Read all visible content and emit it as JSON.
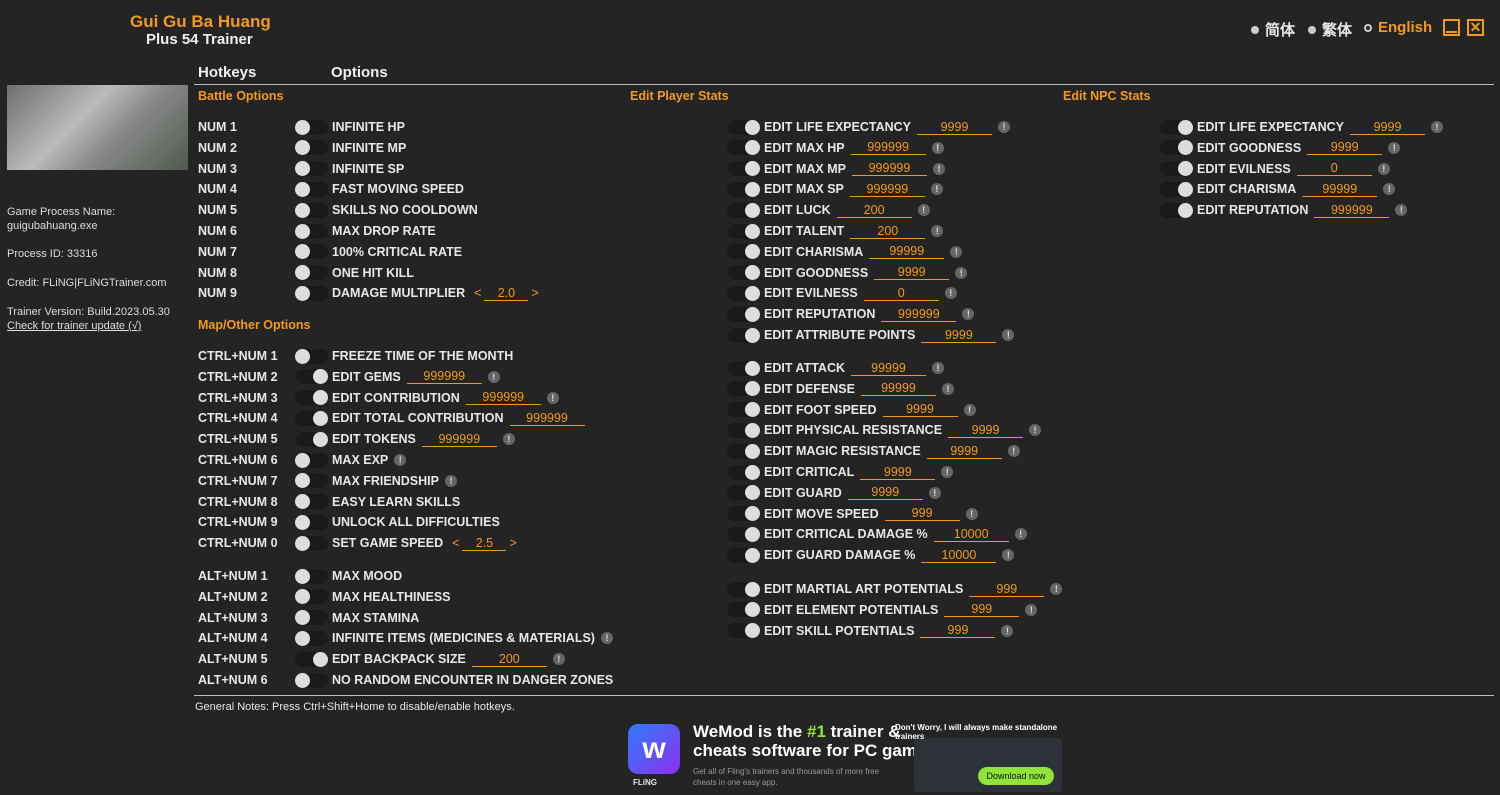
{
  "app": {
    "title": "Gui Gu Ba Huang",
    "subtitle": "Plus 54 Trainer"
  },
  "languages": [
    {
      "label": "简体",
      "selected": false
    },
    {
      "label": "繁体",
      "selected": false
    },
    {
      "label": "English",
      "selected": true
    }
  ],
  "window": {
    "minimize_icon": "minimize-icon",
    "close_icon": "close-icon"
  },
  "headers": {
    "hotkeys": "Hotkeys",
    "options": "Options"
  },
  "colors": {
    "accent": "#f39a1e",
    "background": "#242424"
  },
  "info": {
    "process_name_label": "Game Process Name:",
    "process_name": "guigubahuang.exe",
    "process_id": "Process ID: 33316",
    "credit": "Credit: FLiNG|FLiNGTrainer.com",
    "version": "Trainer Version: Build.2023.05.30",
    "update_link": "Check for trainer update (√)"
  },
  "sections": {
    "battle": "Battle Options",
    "map": "Map/Other Options",
    "player": "Edit Player Stats",
    "npc": "Edit NPC Stats"
  },
  "battle": [
    {
      "hotkey": "NUM 1",
      "label": "INFINITE HP"
    },
    {
      "hotkey": "NUM 2",
      "label": "INFINITE MP"
    },
    {
      "hotkey": "NUM 3",
      "label": "INFINITE SP"
    },
    {
      "hotkey": "NUM 4",
      "label": "FAST MOVING SPEED"
    },
    {
      "hotkey": "NUM 5",
      "label": "SKILLS NO COOLDOWN"
    },
    {
      "hotkey": "NUM 6",
      "label": "MAX DROP RATE"
    },
    {
      "hotkey": "NUM 7",
      "label": "100% CRITICAL RATE"
    },
    {
      "hotkey": "NUM 8",
      "label": "ONE HIT KILL"
    },
    {
      "hotkey": "NUM 9",
      "label": "DAMAGE MULTIPLIER",
      "stepper": "2.0"
    }
  ],
  "map": [
    {
      "hotkey": "CTRL+NUM 1",
      "label": "FREEZE TIME OF THE MONTH"
    },
    {
      "hotkey": "CTRL+NUM 2",
      "label": "EDIT GEMS",
      "value": "999999",
      "info": true
    },
    {
      "hotkey": "CTRL+NUM 3",
      "label": "EDIT CONTRIBUTION",
      "value": "999999",
      "info": true
    },
    {
      "hotkey": "CTRL+NUM 4",
      "label": "EDIT TOTAL CONTRIBUTION",
      "value": "999999"
    },
    {
      "hotkey": "CTRL+NUM 5",
      "label": "EDIT TOKENS",
      "value": "999999",
      "info": true
    },
    {
      "hotkey": "CTRL+NUM 6",
      "label": "MAX EXP",
      "info": true
    },
    {
      "hotkey": "CTRL+NUM 7",
      "label": "MAX FRIENDSHIP",
      "info": true
    },
    {
      "hotkey": "CTRL+NUM 8",
      "label": "EASY LEARN SKILLS"
    },
    {
      "hotkey": "CTRL+NUM 9",
      "label": "UNLOCK ALL DIFFICULTIES"
    },
    {
      "hotkey": "CTRL+NUM 0",
      "label": "SET GAME SPEED",
      "stepper": "2.5"
    }
  ],
  "alt": [
    {
      "hotkey": "ALT+NUM 1",
      "label": "MAX MOOD"
    },
    {
      "hotkey": "ALT+NUM 2",
      "label": "MAX HEALTHINESS"
    },
    {
      "hotkey": "ALT+NUM 3",
      "label": "MAX STAMINA"
    },
    {
      "hotkey": "ALT+NUM 4",
      "label": "INFINITE ITEMS (MEDICINES & MATERIALS)",
      "info": true
    },
    {
      "hotkey": "ALT+NUM 5",
      "label": "EDIT BACKPACK SIZE",
      "value": "200",
      "info": true
    },
    {
      "hotkey": "ALT+NUM 6",
      "label": "NO RANDOM ENCOUNTER IN DANGER ZONES"
    }
  ],
  "player": [
    [
      {
        "label": "EDIT LIFE EXPECTANCY",
        "value": "9999"
      },
      {
        "label": "EDIT MAX HP",
        "value": "999999"
      },
      {
        "label": "EDIT MAX MP",
        "value": "999999"
      },
      {
        "label": "EDIT MAX SP",
        "value": "999999"
      },
      {
        "label": "EDIT LUCK",
        "value": "200"
      },
      {
        "label": "EDIT TALENT",
        "value": "200"
      },
      {
        "label": "EDIT CHARISMA",
        "value": "99999"
      },
      {
        "label": "EDIT GOODNESS",
        "value": "9999"
      },
      {
        "label": "EDIT EVILNESS",
        "value": "0"
      },
      {
        "label": "EDIT REPUTATION",
        "value": "999999"
      },
      {
        "label": "EDIT ATTRIBUTE POINTS",
        "value": "9999"
      }
    ],
    [
      {
        "label": "EDIT ATTACK",
        "value": "99999"
      },
      {
        "label": "EDIT DEFENSE",
        "value": "99999"
      },
      {
        "label": "EDIT FOOT SPEED",
        "value": "9999"
      },
      {
        "label": "EDIT PHYSICAL RESISTANCE",
        "value": "9999"
      },
      {
        "label": "EDIT MAGIC RESISTANCE",
        "value": "9999"
      },
      {
        "label": "EDIT CRITICAL",
        "value": "9999"
      },
      {
        "label": "EDIT GUARD",
        "value": "9999"
      },
      {
        "label": "EDIT MOVE SPEED",
        "value": "999"
      },
      {
        "label": "EDIT CRITICAL DAMAGE %",
        "value": "10000"
      },
      {
        "label": "EDIT GUARD DAMAGE %",
        "value": "10000"
      }
    ],
    [
      {
        "label": "EDIT MARTIAL ART POTENTIALS",
        "value": "999"
      },
      {
        "label": "EDIT ELEMENT POTENTIALS",
        "value": "999"
      },
      {
        "label": "EDIT SKILL POTENTIALS",
        "value": "999"
      }
    ]
  ],
  "npc": [
    {
      "label": "EDIT LIFE EXPECTANCY",
      "value": "9999"
    },
    {
      "label": "EDIT GOODNESS",
      "value": "9999"
    },
    {
      "label": "EDIT EVILNESS",
      "value": "0"
    },
    {
      "label": "EDIT CHARISMA",
      "value": "99999"
    },
    {
      "label": "EDIT REPUTATION",
      "value": "999999"
    }
  ],
  "notes": "General Notes: Press Ctrl+Shift+Home to disable/enable hotkeys.",
  "ad": {
    "headline_pre": "WeMod is the ",
    "headline_hl": "#1",
    "headline_post": " trainer &",
    "headline2": "cheats software for PC games",
    "sub1": "Get all of Fling's trainers and thousands of more free",
    "sub2": "cheats in one easy app.",
    "brand": "FLiNG",
    "tagline": "Don't Worry, I will always make standalone trainers",
    "download": "Download now",
    "highlight_color": "#8fe33a"
  }
}
